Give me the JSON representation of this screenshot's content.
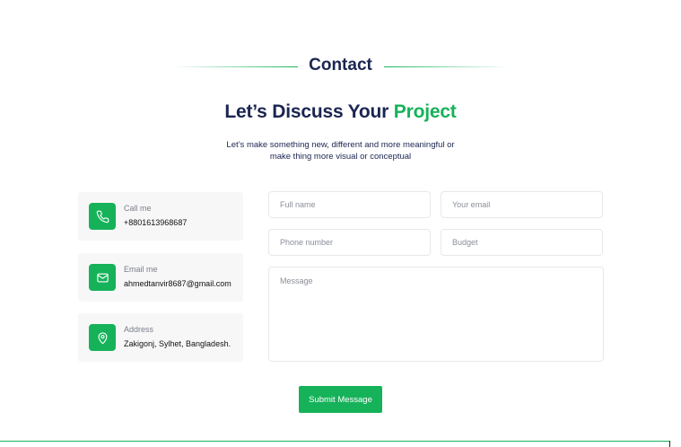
{
  "section": {
    "title": "Contact"
  },
  "heading": {
    "prefix": "Let’s Discuss Your ",
    "accent": "Project"
  },
  "subtext": {
    "line1": "Let’s make something new, different and more meaningful or",
    "line2": "make thing more visual or conceptual"
  },
  "contact_info": [
    {
      "icon": "phone-icon",
      "label": "Call me",
      "value": "+8801613968687"
    },
    {
      "icon": "mail-icon",
      "label": "Email me",
      "value": "ahmedtanvir8687@gmail.com"
    },
    {
      "icon": "location-pin-icon",
      "label": "Address",
      "value": "Zakigonj, Sylhet, Bangladesh."
    }
  ],
  "form": {
    "full_name_placeholder": "Full name",
    "email_placeholder": "Your email",
    "phone_placeholder": "Phone number",
    "budget_placeholder": "Budget",
    "message_placeholder": "Message",
    "submit_label": "Submit Message"
  },
  "colors": {
    "accent": "#16b25a",
    "heading": "#1b2551",
    "card_bg": "#f7f7f8"
  }
}
